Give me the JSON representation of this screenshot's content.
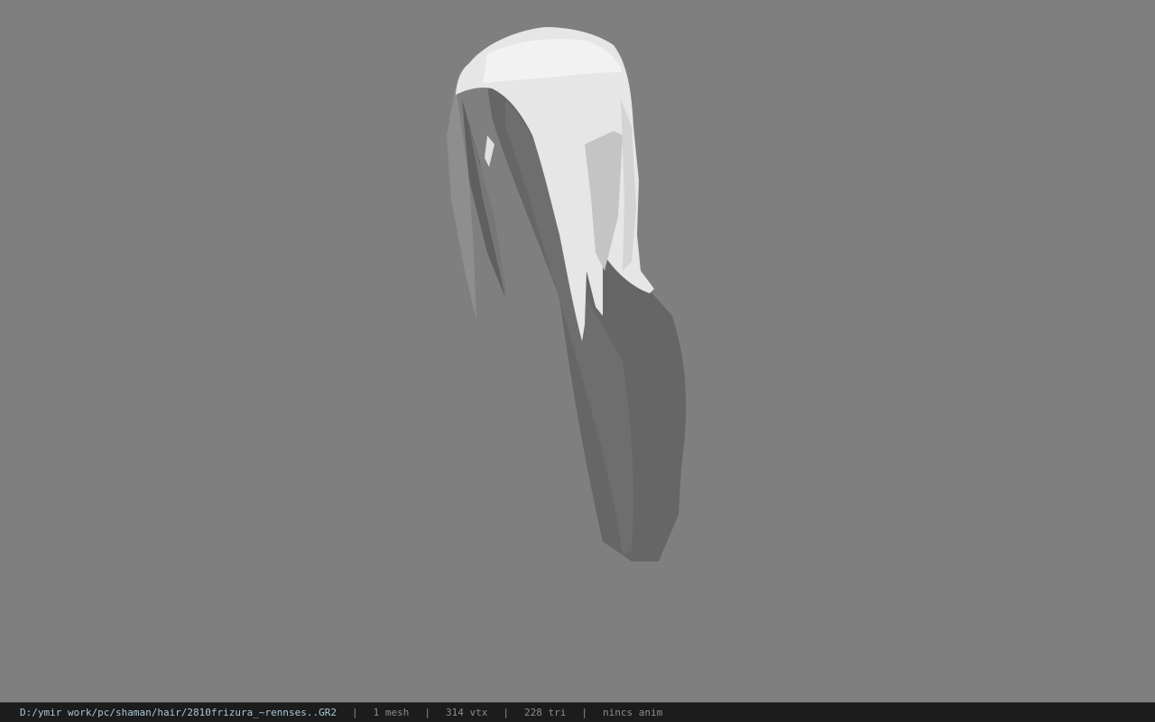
{
  "viewport": {
    "background_color": "#7f7f7f",
    "model": {
      "subject": "hair mesh",
      "light_color": "#e6e6e6",
      "shadow_color": "#666666"
    }
  },
  "status_bar": {
    "file_path": "D:/ymir work/pc/shaman/hair/2810frizura_~rennses..GR2",
    "separator": "|",
    "mesh_count": "1 mesh",
    "vertex_count": "314 vtx",
    "triangle_count": "228 tri",
    "anim_status": "nincs anim"
  }
}
